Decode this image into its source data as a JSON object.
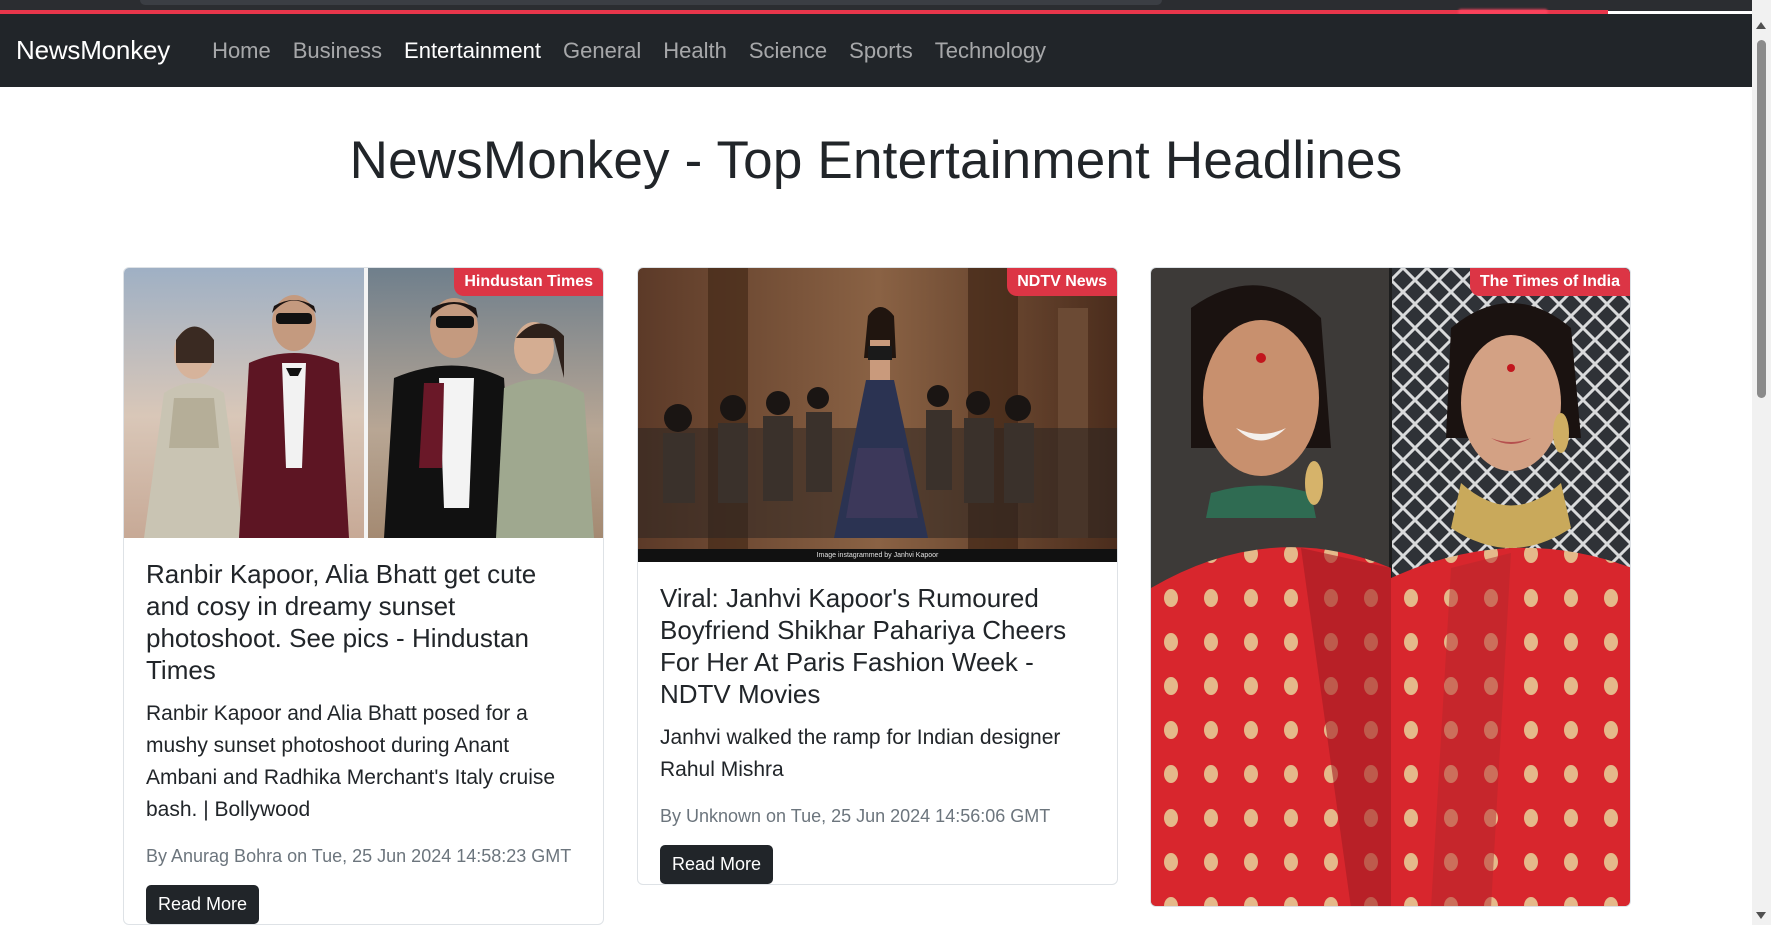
{
  "navbar": {
    "brand": "NewsMonkey",
    "links": [
      {
        "label": "Home",
        "active": false
      },
      {
        "label": "Business",
        "active": false
      },
      {
        "label": "Entertainment",
        "active": true
      },
      {
        "label": "General",
        "active": false
      },
      {
        "label": "Health",
        "active": false
      },
      {
        "label": "Science",
        "active": false
      },
      {
        "label": "Sports",
        "active": false
      },
      {
        "label": "Technology",
        "active": false
      }
    ]
  },
  "page": {
    "title": "NewsMonkey - Top Entertainment Headlines"
  },
  "articles": [
    {
      "source": "Hindustan Times",
      "title": "Ranbir Kapoor, Alia Bhatt get cute and cosy in dreamy sunset photoshoot. See pics - Hindustan Times",
      "description": "Ranbir Kapoor and Alia Bhatt posed for a mushy sunset photoshoot during Anant Ambani and Radhika Merchant's Italy cruise bash. | Bollywood",
      "meta": "By Anurag Bohra on Tue, 25 Jun 2024 14:58:23 GMT",
      "button": "Read More"
    },
    {
      "source": "NDTV News",
      "title": "Viral: Janhvi Kapoor's Rumoured Boyfriend Shikhar Pahariya Cheers For Her At Paris Fashion Week - NDTV Movies",
      "description": "Janhvi walked the ramp for Indian designer Rahul Mishra",
      "meta": "By Unknown on Tue, 25 Jun 2024 14:56:06 GMT",
      "button": "Read More",
      "image_caption": "Image instagrammed by Janhvi Kapoor"
    },
    {
      "source": "The Times of India"
    }
  ],
  "colors": {
    "navbar_bg": "#212529",
    "badge_bg": "#dc3545",
    "loading_bar": "#e8364b",
    "button_bg": "#212529"
  }
}
